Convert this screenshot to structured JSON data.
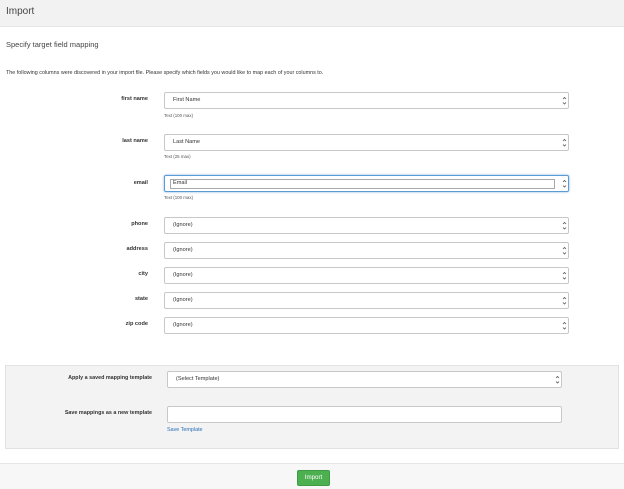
{
  "header": {
    "title": "Import"
  },
  "subtitle": "Specify target field mapping",
  "intro": "The following columns were discovered in your import file. Please specify which fields you would like to map each of your columns to.",
  "fields": [
    {
      "label": "first name",
      "value": "First Name",
      "hint": "Text (100 max)"
    },
    {
      "label": "last name",
      "value": "Last Name",
      "hint": "Text (25 max)"
    },
    {
      "label": "email",
      "value": "Email",
      "hint": "Text (100 max)"
    },
    {
      "label": "phone",
      "value": "(Ignore)",
      "hint": ""
    },
    {
      "label": "address",
      "value": "(Ignore)",
      "hint": ""
    },
    {
      "label": "city",
      "value": "(Ignore)",
      "hint": ""
    },
    {
      "label": "state",
      "value": "(Ignore)",
      "hint": ""
    },
    {
      "label": "zip code",
      "value": "(Ignore)",
      "hint": ""
    }
  ],
  "template": {
    "apply_label": "Apply a saved mapping template",
    "apply_value": "(Select Template)",
    "save_label": "Save mappings as a new template",
    "save_input_value": "",
    "save_link": "Save Template"
  },
  "footer": {
    "import_label": "Import"
  },
  "colors": {
    "accent": "#4caf50",
    "link": "#2a6ebb",
    "focus": "#5b9bd5"
  }
}
